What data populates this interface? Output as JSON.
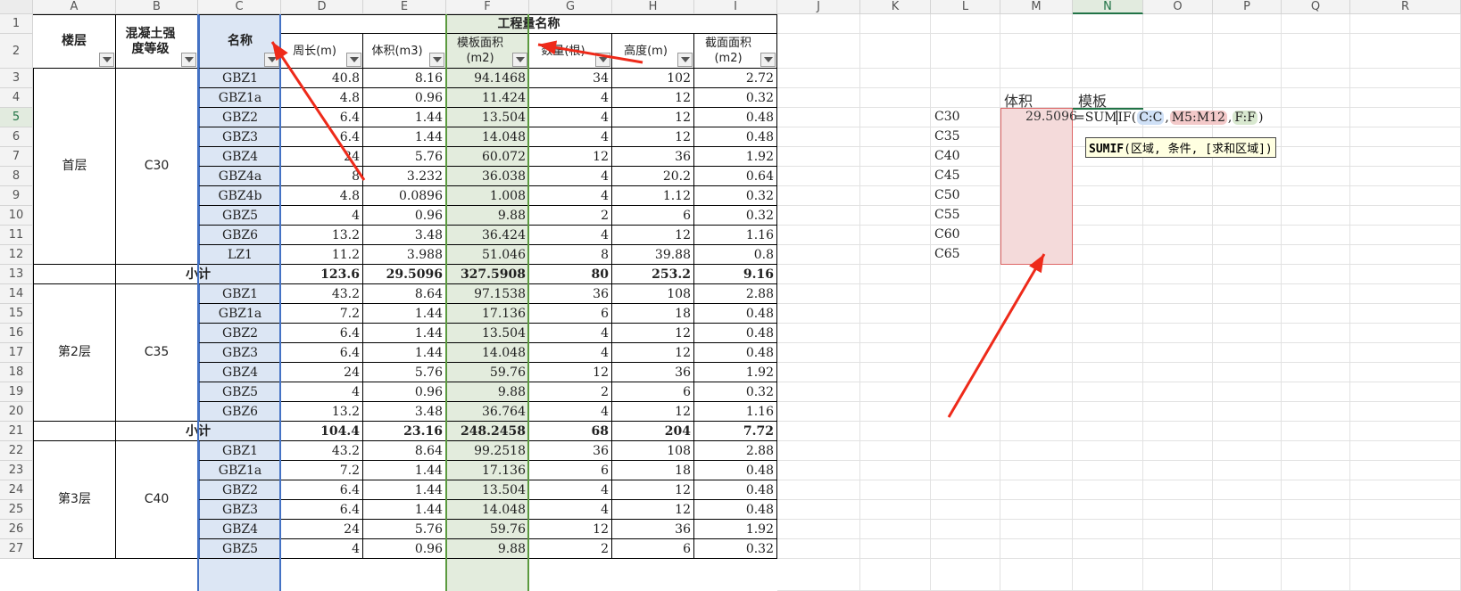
{
  "columns": [
    "A",
    "B",
    "C",
    "D",
    "E",
    "F",
    "G",
    "H",
    "I",
    "J",
    "K",
    "L",
    "M",
    "N",
    "O",
    "P",
    "Q",
    "R"
  ],
  "active_column": "N",
  "active_row": "5",
  "rows": [
    "1",
    "2",
    "3",
    "4",
    "5",
    "6",
    "7",
    "8",
    "9",
    "10",
    "11",
    "12",
    "13",
    "14",
    "15",
    "16",
    "17",
    "18",
    "19",
    "20",
    "21",
    "22",
    "23",
    "24",
    "25",
    "26",
    "27"
  ],
  "header": {
    "floor": "楼层",
    "grade": "混凝土强度等级",
    "name": "名称",
    "quantity_group": "工程量名称",
    "perimeter": "周长(m)",
    "volume": "体积(m3)",
    "formwork": "模板面积(m2)",
    "count": "数量(根)",
    "height": "高度(m)",
    "section": "截面面积(m2)"
  },
  "groups": [
    {
      "floor": "首层",
      "grade": "C30",
      "items": [
        [
          "GBZ1",
          "40.8",
          "8.16",
          "94.1468",
          "34",
          "102",
          "2.72"
        ],
        [
          "GBZ1a",
          "4.8",
          "0.96",
          "11.424",
          "4",
          "12",
          "0.32"
        ],
        [
          "GBZ2",
          "6.4",
          "1.44",
          "13.504",
          "4",
          "12",
          "0.48"
        ],
        [
          "GBZ3",
          "6.4",
          "1.44",
          "14.048",
          "4",
          "12",
          "0.48"
        ],
        [
          "GBZ4",
          "24",
          "5.76",
          "60.072",
          "12",
          "36",
          "1.92"
        ],
        [
          "GBZ4a",
          "8",
          "3.232",
          "36.038",
          "4",
          "20.2",
          "0.64"
        ],
        [
          "GBZ4b",
          "4.8",
          "0.0896",
          "1.008",
          "4",
          "1.12",
          "0.32"
        ],
        [
          "GBZ5",
          "4",
          "0.96",
          "9.88",
          "2",
          "6",
          "0.32"
        ],
        [
          "GBZ6",
          "13.2",
          "3.48",
          "36.424",
          "4",
          "12",
          "1.16"
        ],
        [
          "LZ1",
          "11.2",
          "3.988",
          "51.046",
          "8",
          "39.88",
          "0.8"
        ]
      ],
      "subtotal": {
        "label": "小计",
        "values": [
          "123.6",
          "29.5096",
          "327.5908",
          "80",
          "253.2",
          "9.16"
        ]
      }
    },
    {
      "floor": "第2层",
      "grade": "C35",
      "items": [
        [
          "GBZ1",
          "43.2",
          "8.64",
          "97.1538",
          "36",
          "108",
          "2.88"
        ],
        [
          "GBZ1a",
          "7.2",
          "1.44",
          "17.136",
          "6",
          "18",
          "0.48"
        ],
        [
          "GBZ2",
          "6.4",
          "1.44",
          "13.504",
          "4",
          "12",
          "0.48"
        ],
        [
          "GBZ3",
          "6.4",
          "1.44",
          "14.048",
          "4",
          "12",
          "0.48"
        ],
        [
          "GBZ4",
          "24",
          "5.76",
          "59.76",
          "12",
          "36",
          "1.92"
        ],
        [
          "GBZ5",
          "4",
          "0.96",
          "9.88",
          "2",
          "6",
          "0.32"
        ],
        [
          "GBZ6",
          "13.2",
          "3.48",
          "36.764",
          "4",
          "12",
          "1.16"
        ]
      ],
      "subtotal": {
        "label": "小计",
        "values": [
          "104.4",
          "23.16",
          "248.2458",
          "68",
          "204",
          "7.72"
        ]
      }
    },
    {
      "floor": "第3层",
      "grade": "C40",
      "items": [
        [
          "GBZ1",
          "43.2",
          "8.64",
          "99.2518",
          "36",
          "108",
          "2.88"
        ],
        [
          "GBZ1a",
          "7.2",
          "1.44",
          "17.136",
          "6",
          "18",
          "0.48"
        ],
        [
          "GBZ2",
          "6.4",
          "1.44",
          "13.504",
          "4",
          "12",
          "0.48"
        ],
        [
          "GBZ3",
          "6.4",
          "1.44",
          "14.048",
          "4",
          "12",
          "0.48"
        ],
        [
          "GBZ4",
          "24",
          "5.76",
          "59.76",
          "12",
          "36",
          "1.92"
        ],
        [
          "GBZ5",
          "4",
          "0.96",
          "9.88",
          "2",
          "6",
          "0.32"
        ]
      ]
    }
  ],
  "side_table": {
    "headers": {
      "volume": "体积",
      "formwork": "模板"
    },
    "grades": [
      "C30",
      "C35",
      "C40",
      "C45",
      "C50",
      "C55",
      "C60",
      "C65"
    ],
    "first_volume": "29.5096",
    "formula": {
      "prefix": "=SUM",
      "cursor": "IF(",
      "arg1": "C:C",
      "sep1": ",",
      "arg2": "M5:M12",
      "sep2": ",",
      "arg3": "F:F",
      "suffix": ")"
    },
    "tooltip": {
      "func": "SUMIF",
      "args": "(区域, 条件, [求和区域])"
    }
  },
  "colors": {
    "name_col_fill": "#dce6f4",
    "formwork_col_fill": "#e3ecdd",
    "range_fill": "#f4dada",
    "arg1_fill": "#cfe0f6",
    "arg2_fill": "#f3c9c9",
    "arg3_fill": "#d8e8cf",
    "arrow": "#ee2a1a"
  }
}
